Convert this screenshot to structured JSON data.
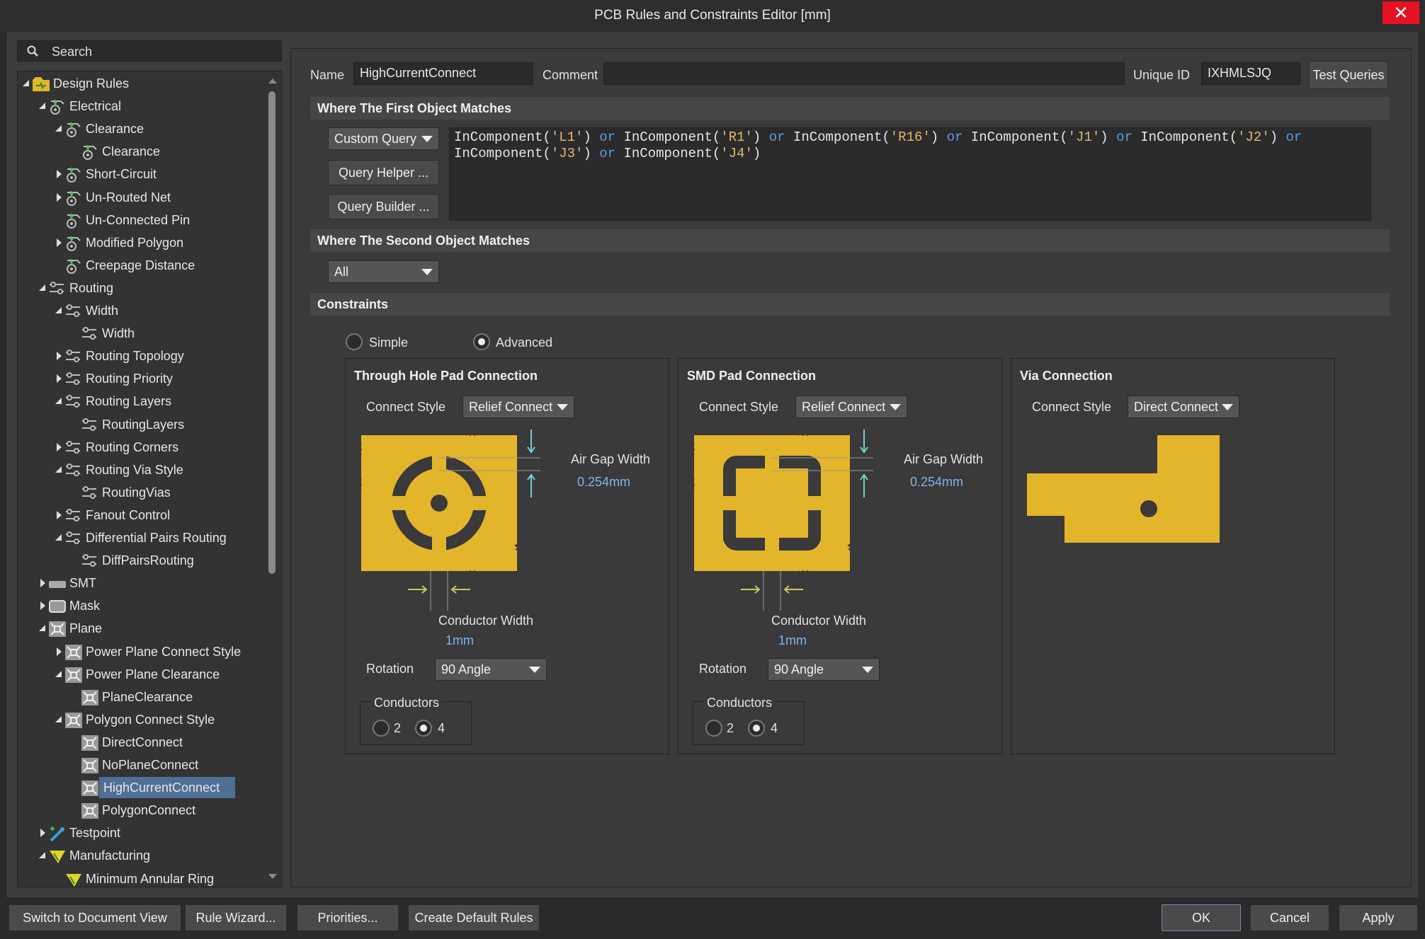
{
  "window": {
    "title": "PCB Rules and Constraints Editor [mm]",
    "close_glyph": "✕"
  },
  "search": {
    "placeholder": "Search"
  },
  "tree": [
    {
      "label": "Design Rules",
      "icon": "design-rules-icon",
      "expander": "expanded"
    },
    {
      "label": "Electrical",
      "icon": "electrical-rule-icon",
      "expander": "expanded"
    },
    {
      "label": "Clearance",
      "icon": "electrical-rule-icon",
      "expander": "expanded"
    },
    {
      "label": "Clearance",
      "icon": "electrical-rule-icon",
      "expander": "none"
    },
    {
      "label": "Short-Circuit",
      "icon": "electrical-rule-icon",
      "expander": "collapsed"
    },
    {
      "label": "Un-Routed Net",
      "icon": "electrical-rule-icon",
      "expander": "collapsed"
    },
    {
      "label": "Un-Connected Pin",
      "icon": "electrical-rule-icon",
      "expander": "none"
    },
    {
      "label": "Modified Polygon",
      "icon": "electrical-rule-icon",
      "expander": "collapsed"
    },
    {
      "label": "Creepage Distance",
      "icon": "electrical-rule-icon",
      "expander": "none"
    },
    {
      "label": "Routing",
      "icon": "routing-rule-icon",
      "expander": "expanded"
    },
    {
      "label": "Width",
      "icon": "routing-rule-icon",
      "expander": "expanded"
    },
    {
      "label": "Width",
      "icon": "routing-rule-icon",
      "expander": "none"
    },
    {
      "label": "Routing Topology",
      "icon": "routing-rule-icon",
      "expander": "collapsed"
    },
    {
      "label": "Routing Priority",
      "icon": "routing-rule-icon",
      "expander": "collapsed"
    },
    {
      "label": "Routing Layers",
      "icon": "routing-rule-icon",
      "expander": "expanded"
    },
    {
      "label": "RoutingLayers",
      "icon": "routing-rule-icon",
      "expander": "none"
    },
    {
      "label": "Routing Corners",
      "icon": "routing-rule-icon",
      "expander": "collapsed"
    },
    {
      "label": "Routing Via Style",
      "icon": "routing-rule-icon",
      "expander": "expanded"
    },
    {
      "label": "RoutingVias",
      "icon": "routing-rule-icon",
      "expander": "none"
    },
    {
      "label": "Fanout Control",
      "icon": "routing-rule-icon",
      "expander": "collapsed"
    },
    {
      "label": "Differential Pairs Routing",
      "icon": "routing-rule-icon",
      "expander": "expanded"
    },
    {
      "label": "DiffPairsRouting",
      "icon": "routing-rule-icon",
      "expander": "none"
    },
    {
      "label": "SMT",
      "icon": "smt-rule-icon",
      "expander": "collapsed"
    },
    {
      "label": "Mask",
      "icon": "mask-rule-icon",
      "expander": "collapsed"
    },
    {
      "label": "Plane",
      "icon": "plane-rule-icon",
      "expander": "expanded"
    },
    {
      "label": "Power Plane Connect Style",
      "icon": "plane-rule-icon",
      "expander": "collapsed"
    },
    {
      "label": "Power Plane Clearance",
      "icon": "plane-rule-icon",
      "expander": "expanded"
    },
    {
      "label": "PlaneClearance",
      "icon": "plane-rule-icon",
      "expander": "none"
    },
    {
      "label": "Polygon Connect Style",
      "icon": "plane-rule-icon",
      "expander": "expanded"
    },
    {
      "label": "DirectConnect",
      "icon": "plane-rule-icon",
      "expander": "none"
    },
    {
      "label": "NoPlaneConnect",
      "icon": "plane-rule-icon",
      "expander": "none"
    },
    {
      "label": "HighCurrentConnect",
      "icon": "plane-rule-icon",
      "expander": "none",
      "selected": true
    },
    {
      "label": "PolygonConnect",
      "icon": "plane-rule-icon",
      "expander": "none"
    },
    {
      "label": "Testpoint",
      "icon": "testpoint-rule-icon",
      "expander": "collapsed"
    },
    {
      "label": "Manufacturing",
      "icon": "manufacturing-rule-icon",
      "expander": "expanded"
    },
    {
      "label": "Minimum Annular Ring",
      "icon": "manufacturing-rule-icon",
      "expander": "none"
    }
  ],
  "rule": {
    "name_label": "Name",
    "name_value": "HighCurrentConnect",
    "comment_label": "Comment",
    "comment_value": "",
    "uid_label": "Unique ID",
    "uid_value": "IXHMLSJQ",
    "test_queries": "Test Queries"
  },
  "first_match": {
    "header": "Where The First Object Matches",
    "mode": "Custom Query",
    "query_helper": "Query Helper ...",
    "query_builder": "Query Builder ...",
    "query_text": "InComponent('L1') or InComponent('R1') or InComponent('R16') or InComponent('J1') or InComponent('J2') or InComponent('J3') or InComponent('J4')"
  },
  "second_match": {
    "header": "Where The Second Object Matches",
    "mode": "All"
  },
  "constraints": {
    "header": "Constraints",
    "simple_label": "Simple",
    "advanced_label": "Advanced",
    "mode": "advanced",
    "through_hole": {
      "title": "Through Hole Pad Connection",
      "connect_style_label": "Connect Style",
      "connect_style": "Relief Connect",
      "air_gap_label": "Air Gap Width",
      "air_gap": "0.254mm",
      "conductor_width_label": "Conductor Width",
      "conductor_width": "1mm",
      "rotation_label": "Rotation",
      "rotation": "90 Angle",
      "conductors_label": "Conductors",
      "conductors_opt1": "2",
      "conductors_opt2": "4",
      "conductors": 4
    },
    "smd": {
      "title": "SMD Pad Connection",
      "connect_style_label": "Connect Style",
      "connect_style": "Relief Connect",
      "air_gap_label": "Air Gap Width",
      "air_gap": "0.254mm",
      "conductor_width_label": "Conductor Width",
      "conductor_width": "1mm",
      "rotation_label": "Rotation",
      "rotation": "90 Angle",
      "conductors_label": "Conductors",
      "conductors_opt1": "2",
      "conductors_opt2": "4",
      "conductors": 4
    },
    "via": {
      "title": "Via Connection",
      "connect_style_label": "Connect Style",
      "connect_style": "Direct Connect"
    }
  },
  "footer": {
    "switch_view": "Switch to Document View",
    "rule_wizard": "Rule Wizard...",
    "priorities": "Priorities...",
    "create_defaults": "Create Default Rules",
    "ok": "OK",
    "cancel": "Cancel",
    "apply": "Apply"
  },
  "colors": {
    "copper": "#e3b52a",
    "selection": "#4f6f95",
    "value": "#7fb3ea",
    "close": "#e81123"
  }
}
